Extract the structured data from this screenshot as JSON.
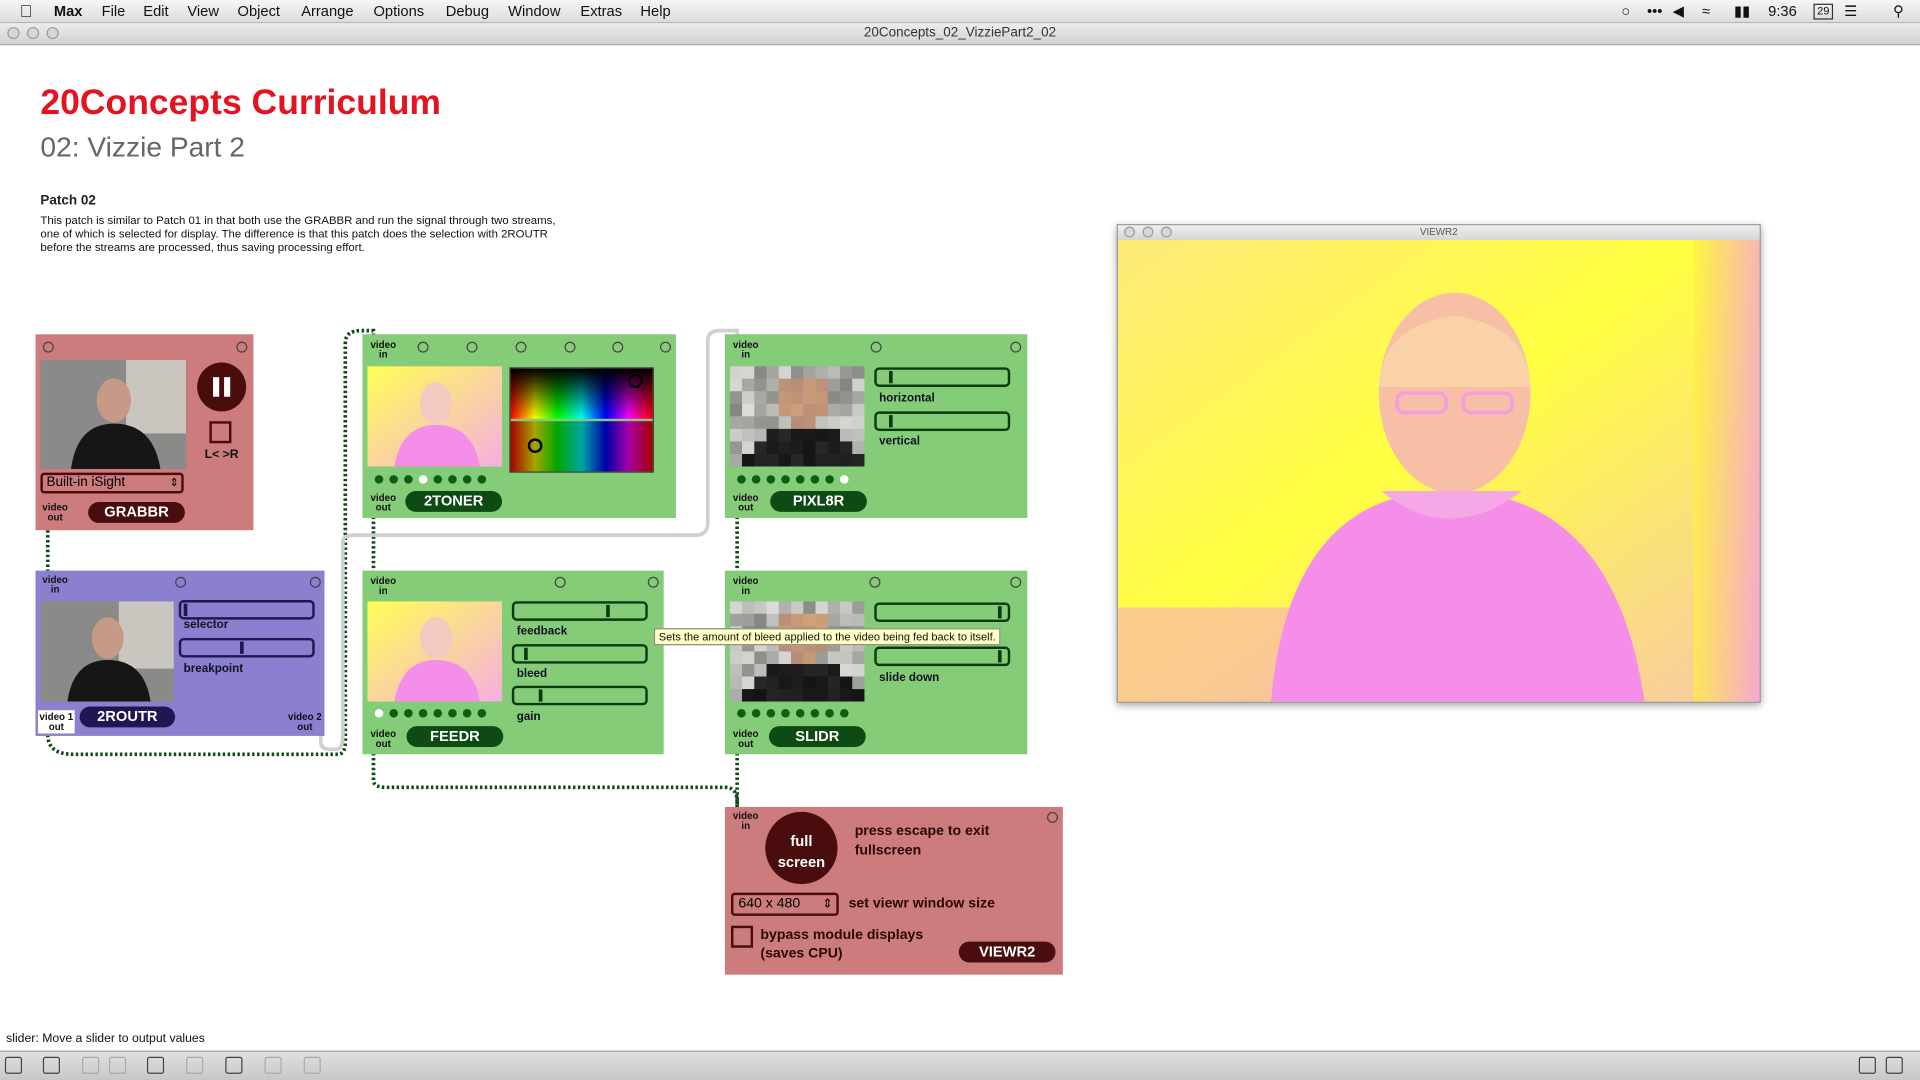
{
  "menubar": {
    "items": [
      "Max",
      "File",
      "Edit",
      "View",
      "Object",
      "Arrange",
      "Options",
      "Debug",
      "Window",
      "Extras",
      "Help"
    ],
    "clock": "9:36",
    "date_badge": "29",
    "icons": [
      "apple-icon",
      "dropbox-icon",
      "dots-icon",
      "volume-icon",
      "wifi-icon",
      "battery-icon",
      "calendar-icon",
      "list-icon",
      "spotlight-icon"
    ]
  },
  "window": {
    "title": "20Concepts_02_VizziePart2_02"
  },
  "patch": {
    "title": "20Concepts Curriculum",
    "subtitle": "02: Vizzie Part 2",
    "note_title": "Patch 02",
    "note_body": "This patch is similar to Patch 01 in that both use the GRABBR and run the signal through two streams, one of which is selected for display. The difference is that this patch does the selection with  2ROUTR before the streams are processed, thus saving processing effort."
  },
  "modules": {
    "grabbr": {
      "name": "GRABBR",
      "device": "Built-in iSight",
      "port_label": "video out",
      "toggle_label": "L< >R"
    },
    "routr": {
      "name": "2ROUTR",
      "in_label": "video in",
      "out1_label": "video 1 out",
      "out2_label": "video 2 out",
      "slider1": "selector",
      "slider2": "breakpoint",
      "slider1_value": 0.0,
      "slider2_value": 0.45
    },
    "toner": {
      "name": "2TONER",
      "in_label": "video in",
      "out_label": "video out"
    },
    "pixl8r": {
      "name": "PIXL8R",
      "in_label": "video in",
      "out_label": "video out",
      "slider1": "horizontal",
      "slider2": "vertical",
      "slider1_value": 0.08,
      "slider2_value": 0.08
    },
    "feedr": {
      "name": "FEEDR",
      "in_label": "video in",
      "out_label": "video out",
      "slider1": "feedback",
      "slider2": "bleed",
      "slider3": "gain",
      "slider1_value": 0.72,
      "slider2_value": 0.06,
      "slider3_value": 0.18
    },
    "slidr": {
      "name": "SLIDR",
      "in_label": "video in",
      "out_label": "video out",
      "slider1": "",
      "slider2": "slide down",
      "slider1_value": 0.95,
      "slider2_value": 0.95
    },
    "viewr2": {
      "name": "VIEWR2",
      "in_label": "video in",
      "fullscreen_label": "full screen",
      "escape_note": "press escape to exit fullscreen",
      "window_size": "640 x 480",
      "size_note": "set viewr window size",
      "bypass_note": "bypass module displays (saves CPU)"
    }
  },
  "viewer": {
    "title": "VIEWR2"
  },
  "tooltip": "Sets the amount of bleed applied to the video being fed back to itself.",
  "status": "slider: Move a slider to output values",
  "colors": {
    "title_red": "#e3131f",
    "pink_module": "#cc7c7c",
    "green_module": "#85cc78",
    "purple_module": "#8a80cf"
  }
}
